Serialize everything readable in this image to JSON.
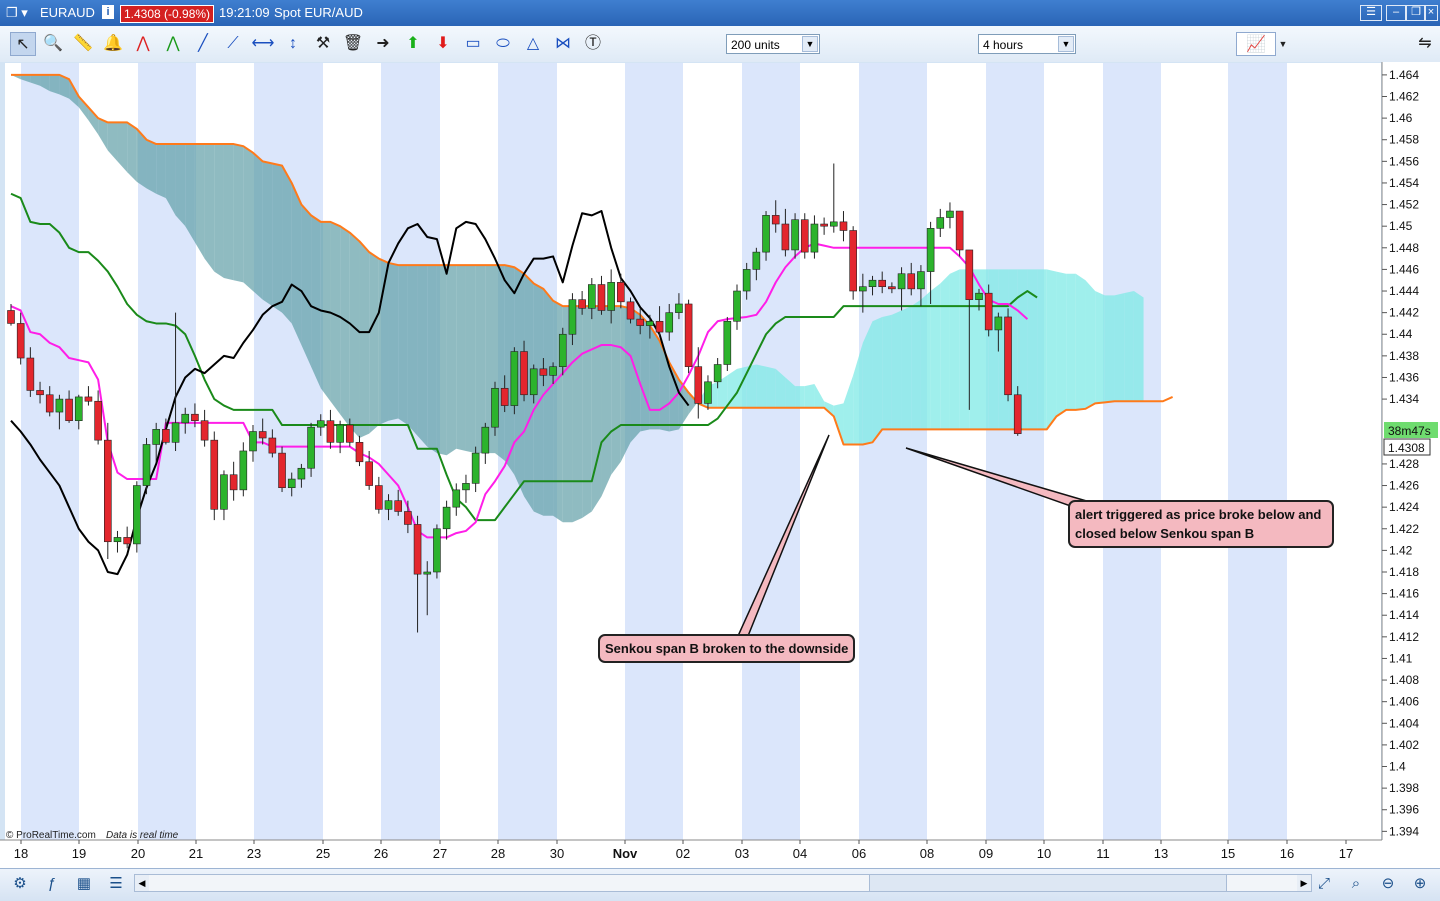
{
  "window": {
    "symbol": "EURAUD",
    "info_icon": "i",
    "price_change": "1.4308 (-0.98%)",
    "time": "19:21:09",
    "instrument": "Spot EUR/AUD"
  },
  "toolbar": {
    "tools": [
      "cursor-icon",
      "zoom-icon",
      "ruler-icon",
      "alert-bell-icon",
      "trend-line-red-icon",
      "trend-line-green-icon",
      "line-icon",
      "ray-icon",
      "horizontal-line-icon",
      "vertical-line-icon",
      "tools-icon",
      "trash-icon",
      "arrow-right-icon",
      "arrow-up-icon",
      "arrow-down-icon",
      "rectangle-icon",
      "ellipse-icon",
      "triangle-icon",
      "fibonacci-icon",
      "text-icon"
    ],
    "units_value": "200 units",
    "timeframe_value": "4 hours"
  },
  "chart_data": {
    "type": "candlestick",
    "instrument": "EUR/AUD",
    "y_axis": {
      "ticks": [
        "1.464",
        "1.462",
        "1.46",
        "1.458",
        "1.456",
        "1.454",
        "1.452",
        "1.45",
        "1.448",
        "1.446",
        "1.444",
        "1.442",
        "1.44",
        "1.438",
        "1.436",
        "1.434",
        "1.428",
        "1.426",
        "1.424",
        "1.422",
        "1.42",
        "1.418",
        "1.416",
        "1.414",
        "1.412",
        "1.41",
        "1.408",
        "1.406",
        "1.404",
        "1.402",
        "1.4",
        "1.398",
        "1.396",
        "1.394"
      ],
      "ylim": [
        1.3932,
        1.4651
      ]
    },
    "x_axis": {
      "ticks": [
        "18",
        "19",
        "20",
        "21",
        "23",
        "25",
        "26",
        "27",
        "28",
        "30",
        "Nov",
        "02",
        "03",
        "04",
        "06",
        "08",
        "09",
        "10",
        "11",
        "13",
        "15",
        "16",
        "17"
      ]
    },
    "countdown_label": "38m47s",
    "current_price_label": "1.4308",
    "current_price": 1.4308,
    "candles": [
      [
        1.4422,
        1.4428,
        1.4408,
        1.441
      ],
      [
        1.441,
        1.442,
        1.4372,
        1.4378
      ],
      [
        1.4378,
        1.4388,
        1.4342,
        1.4348
      ],
      [
        1.4348,
        1.4356,
        1.4336,
        1.4344
      ],
      [
        1.4344,
        1.4352,
        1.4324,
        1.4328
      ],
      [
        1.4328,
        1.4344,
        1.4312,
        1.434
      ],
      [
        1.434,
        1.4348,
        1.4318,
        1.432
      ],
      [
        1.432,
        1.4344,
        1.4312,
        1.4342
      ],
      [
        1.4342,
        1.4352,
        1.4334,
        1.4338
      ],
      [
        1.4338,
        1.4348,
        1.4298,
        1.4302
      ],
      [
        1.4302,
        1.4318,
        1.4192,
        1.4208
      ],
      [
        1.4208,
        1.4218,
        1.4198,
        1.4212
      ],
      [
        1.4212,
        1.4222,
        1.4202,
        1.4206
      ],
      [
        1.4206,
        1.4264,
        1.4198,
        1.426
      ],
      [
        1.426,
        1.4304,
        1.4252,
        1.4298
      ],
      [
        1.4298,
        1.4318,
        1.4282,
        1.4312
      ],
      [
        1.4312,
        1.4322,
        1.4298,
        1.43
      ],
      [
        1.43,
        1.442,
        1.4292,
        1.4318
      ],
      [
        1.4318,
        1.4332,
        1.4308,
        1.4326
      ],
      [
        1.4326,
        1.4336,
        1.4314,
        1.432
      ],
      [
        1.432,
        1.433,
        1.4296,
        1.4302
      ],
      [
        1.4302,
        1.431,
        1.4228,
        1.4238
      ],
      [
        1.4238,
        1.4274,
        1.4228,
        1.427
      ],
      [
        1.427,
        1.4282,
        1.4246,
        1.4256
      ],
      [
        1.4256,
        1.43,
        1.425,
        1.4292
      ],
      [
        1.4292,
        1.4316,
        1.4282,
        1.431
      ],
      [
        1.431,
        1.4322,
        1.4298,
        1.4304
      ],
      [
        1.4304,
        1.4312,
        1.4286,
        1.429
      ],
      [
        1.429,
        1.4296,
        1.4254,
        1.4258
      ],
      [
        1.4258,
        1.4272,
        1.425,
        1.4266
      ],
      [
        1.4266,
        1.428,
        1.4258,
        1.4276
      ],
      [
        1.4276,
        1.4318,
        1.4268,
        1.4314
      ],
      [
        1.4314,
        1.4326,
        1.4306,
        1.432
      ],
      [
        1.432,
        1.433,
        1.4294,
        1.43
      ],
      [
        1.43,
        1.432,
        1.429,
        1.4316
      ],
      [
        1.4316,
        1.4322,
        1.4296,
        1.43
      ],
      [
        1.43,
        1.4306,
        1.4278,
        1.4282
      ],
      [
        1.4282,
        1.4292,
        1.4256,
        1.426
      ],
      [
        1.426,
        1.4268,
        1.4234,
        1.4238
      ],
      [
        1.4238,
        1.4252,
        1.4228,
        1.4246
      ],
      [
        1.4246,
        1.4256,
        1.4232,
        1.4236
      ],
      [
        1.4236,
        1.4246,
        1.4216,
        1.4224
      ],
      [
        1.4224,
        1.4232,
        1.4124,
        1.4178
      ],
      [
        1.4178,
        1.419,
        1.414,
        1.418
      ],
      [
        1.418,
        1.4224,
        1.4174,
        1.422
      ],
      [
        1.422,
        1.4246,
        1.421,
        1.424
      ],
      [
        1.424,
        1.4262,
        1.4232,
        1.4256
      ],
      [
        1.4256,
        1.427,
        1.4244,
        1.4262
      ],
      [
        1.4262,
        1.4296,
        1.4254,
        1.429
      ],
      [
        1.429,
        1.4318,
        1.428,
        1.4314
      ],
      [
        1.4314,
        1.4356,
        1.4306,
        1.435
      ],
      [
        1.435,
        1.4362,
        1.4328,
        1.4334
      ],
      [
        1.4334,
        1.4388,
        1.4326,
        1.4384
      ],
      [
        1.4384,
        1.4394,
        1.4338,
        1.4344
      ],
      [
        1.4344,
        1.4372,
        1.4336,
        1.4368
      ],
      [
        1.4368,
        1.4378,
        1.4352,
        1.4362
      ],
      [
        1.4362,
        1.4374,
        1.4354,
        1.437
      ],
      [
        1.437,
        1.4406,
        1.4362,
        1.44
      ],
      [
        1.44,
        1.4438,
        1.439,
        1.4432
      ],
      [
        1.4432,
        1.444,
        1.4418,
        1.4424
      ],
      [
        1.4424,
        1.4452,
        1.4414,
        1.4446
      ],
      [
        1.4446,
        1.4454,
        1.4418,
        1.4422
      ],
      [
        1.4422,
        1.446,
        1.441,
        1.4448
      ],
      [
        1.4448,
        1.4456,
        1.4424,
        1.443
      ],
      [
        1.443,
        1.4434,
        1.441,
        1.4414
      ],
      [
        1.4414,
        1.4424,
        1.44,
        1.4408
      ],
      [
        1.4408,
        1.4418,
        1.4396,
        1.4412
      ],
      [
        1.4412,
        1.4426,
        1.4398,
        1.4402
      ],
      [
        1.4402,
        1.4428,
        1.4394,
        1.442
      ],
      [
        1.442,
        1.4438,
        1.4414,
        1.4428
      ],
      [
        1.4428,
        1.4432,
        1.4364,
        1.437
      ],
      [
        1.437,
        1.4388,
        1.4322,
        1.4336
      ],
      [
        1.4336,
        1.4362,
        1.433,
        1.4356
      ],
      [
        1.4356,
        1.4378,
        1.435,
        1.4372
      ],
      [
        1.4372,
        1.4416,
        1.4366,
        1.4412
      ],
      [
        1.4412,
        1.4446,
        1.4404,
        1.444
      ],
      [
        1.444,
        1.4466,
        1.4432,
        1.446
      ],
      [
        1.446,
        1.448,
        1.445,
        1.4476
      ],
      [
        1.4476,
        1.4514,
        1.4468,
        1.451
      ],
      [
        1.451,
        1.4524,
        1.4494,
        1.4502
      ],
      [
        1.4502,
        1.4516,
        1.4472,
        1.4478
      ],
      [
        1.4478,
        1.4512,
        1.447,
        1.4506
      ],
      [
        1.4506,
        1.4512,
        1.447,
        1.4476
      ],
      [
        1.4476,
        1.451,
        1.447,
        1.4502
      ],
      [
        1.4502,
        1.4508,
        1.4492,
        1.45
      ],
      [
        1.45,
        1.4558,
        1.4494,
        1.4504
      ],
      [
        1.4504,
        1.4514,
        1.4486,
        1.4496
      ],
      [
        1.4496,
        1.45,
        1.4432,
        1.444
      ],
      [
        1.444,
        1.4456,
        1.442,
        1.4444
      ],
      [
        1.4444,
        1.4454,
        1.4436,
        1.445
      ],
      [
        1.445,
        1.4458,
        1.4438,
        1.4444
      ],
      [
        1.4444,
        1.4448,
        1.4438,
        1.4442
      ],
      [
        1.4442,
        1.4462,
        1.4422,
        1.4456
      ],
      [
        1.4456,
        1.4466,
        1.4436,
        1.4442
      ],
      [
        1.4442,
        1.4464,
        1.4426,
        1.4458
      ],
      [
        1.4458,
        1.4504,
        1.4428,
        1.4498
      ],
      [
        1.4498,
        1.4516,
        1.449,
        1.4508
      ],
      [
        1.4508,
        1.4522,
        1.4498,
        1.4514
      ],
      [
        1.4514,
        1.4504,
        1.4472,
        1.4478
      ],
      [
        1.4478,
        1.4478,
        1.433,
        1.4432
      ],
      [
        1.4432,
        1.4442,
        1.4422,
        1.4438
      ],
      [
        1.4438,
        1.4446,
        1.4398,
        1.4404
      ],
      [
        1.4404,
        1.442,
        1.4384,
        1.4416
      ],
      [
        1.4416,
        1.4424,
        1.4338,
        1.4344
      ],
      [
        1.4344,
        1.4352,
        1.4306,
        1.4308
      ]
    ],
    "ichimoku": {
      "tenkan_sen": [
        1.4426,
        1.4422,
        1.4402,
        1.44,
        1.4392,
        1.4388,
        1.4378,
        1.4376,
        1.4374,
        1.4358,
        1.43,
        1.4272,
        1.4266,
        1.4266,
        1.4266,
        1.4266,
        1.4318,
        1.4318,
        1.4318,
        1.4318,
        1.4318,
        1.4318,
        1.4318,
        1.4318,
        1.4318,
        1.43,
        1.43,
        1.4296,
        1.4296,
        1.4296,
        1.4296,
        1.4296,
        1.4296,
        1.4296,
        1.4296,
        1.4296,
        1.429,
        1.4286,
        1.428,
        1.427,
        1.426,
        1.424,
        1.4218,
        1.4212,
        1.4212,
        1.4212,
        1.4216,
        1.4218,
        1.4226,
        1.4252,
        1.4264,
        1.4278,
        1.43,
        1.431,
        1.433,
        1.4344,
        1.4354,
        1.4364,
        1.4374,
        1.4382,
        1.4386,
        1.439,
        1.439,
        1.4388,
        1.438,
        1.4354,
        1.433,
        1.433,
        1.4336,
        1.4346,
        1.4362,
        1.438,
        1.4402,
        1.4412,
        1.4414,
        1.4415,
        1.4416,
        1.4418,
        1.443,
        1.4448,
        1.4462,
        1.4472,
        1.448,
        1.4484,
        1.4482,
        1.448,
        1.448,
        1.448,
        1.448,
        1.448,
        1.448,
        1.448,
        1.448,
        1.448,
        1.448,
        1.448,
        1.448,
        1.448,
        1.4472,
        1.4462,
        1.4446,
        1.4432,
        1.4428,
        1.4428,
        1.4422,
        1.4414
      ],
      "kijun_sen": [
        1.453,
        1.4526,
        1.4504,
        1.4502,
        1.4502,
        1.4494,
        1.448,
        1.4476,
        1.4476,
        1.4468,
        1.4458,
        1.4444,
        1.4428,
        1.4418,
        1.4412,
        1.441,
        1.441,
        1.4408,
        1.44,
        1.438,
        1.4358,
        1.434,
        1.4334,
        1.433,
        1.433,
        1.433,
        1.433,
        1.433,
        1.4316,
        1.4316,
        1.4316,
        1.4316,
        1.4316,
        1.4316,
        1.4316,
        1.4316,
        1.4316,
        1.4316,
        1.4316,
        1.4316,
        1.4316,
        1.4316,
        1.4294,
        1.4294,
        1.4294,
        1.427,
        1.4248,
        1.424,
        1.4228,
        1.4228,
        1.4228,
        1.424,
        1.4252,
        1.4264,
        1.4264,
        1.4264,
        1.4264,
        1.4264,
        1.4264,
        1.4264,
        1.4264,
        1.43,
        1.431,
        1.4316,
        1.4316,
        1.4316,
        1.4316,
        1.4316,
        1.4316,
        1.4316,
        1.4316,
        1.4316,
        1.4316,
        1.4322,
        1.4334,
        1.4346,
        1.4364,
        1.4382,
        1.44,
        1.441,
        1.4416,
        1.4416,
        1.4416,
        1.4416,
        1.4416,
        1.4416,
        1.4426,
        1.4426,
        1.4426,
        1.4426,
        1.4426,
        1.4426,
        1.4426,
        1.4426,
        1.4426,
        1.4426,
        1.4426,
        1.4426,
        1.4426,
        1.4426,
        1.4426,
        1.4426,
        1.4426,
        1.4426,
        1.4434,
        1.444,
        1.4434
      ],
      "chikou_span": [
        1.432,
        1.431,
        1.4298,
        1.4284,
        1.4272,
        1.426,
        1.424,
        1.422,
        1.4208,
        1.42,
        1.418,
        1.4178,
        1.4196,
        1.423,
        1.4258,
        1.428,
        1.4312,
        1.4342,
        1.436,
        1.4368,
        1.4364,
        1.4372,
        1.438,
        1.4378,
        1.4392,
        1.4404,
        1.4418,
        1.4426,
        1.443,
        1.4446,
        1.444,
        1.4426,
        1.4422,
        1.442,
        1.4416,
        1.441,
        1.4402,
        1.4402,
        1.442,
        1.4466,
        1.4484,
        1.4498,
        1.4502,
        1.449,
        1.4488,
        1.4456,
        1.4498,
        1.4504,
        1.4502,
        1.4488,
        1.447,
        1.445,
        1.4438,
        1.4456,
        1.447,
        1.447,
        1.4472,
        1.4448,
        1.4482,
        1.4512,
        1.451,
        1.4514,
        1.448,
        1.4452,
        1.444,
        1.4425,
        1.4415,
        1.44,
        1.437,
        1.4346,
        1.4334
      ],
      "cloud": {
        "span_a": [
          1.464,
          1.4636,
          1.4633,
          1.463,
          1.4625,
          1.4622,
          1.4618,
          1.461,
          1.4598,
          1.4585,
          1.457,
          1.456,
          1.455,
          1.4541,
          1.4535,
          1.453,
          1.4526,
          1.451,
          1.45,
          1.4485,
          1.447,
          1.4458,
          1.4452,
          1.445,
          1.4448,
          1.444,
          1.4432,
          1.4426,
          1.442,
          1.441,
          1.439,
          1.437,
          1.435,
          1.4338,
          1.4326,
          1.4314,
          1.4304,
          1.4308,
          1.4316,
          1.432,
          1.4322,
          1.4316,
          1.4306,
          1.4296,
          1.429,
          1.4288,
          1.4294,
          1.4292,
          1.429,
          1.429,
          1.429,
          1.4283,
          1.427,
          1.425,
          1.4236,
          1.4232,
          1.4232,
          1.4226,
          1.4226,
          1.423,
          1.4236,
          1.425,
          1.427,
          1.4282,
          1.43,
          1.431,
          1.4312,
          1.4312,
          1.431,
          1.4312,
          1.4326,
          1.4338,
          1.4352,
          1.4356,
          1.4362,
          1.4368,
          1.437,
          1.4372,
          1.437,
          1.4368,
          1.436,
          1.4352,
          1.4352,
          1.4354,
          1.4338,
          1.4334,
          1.4336,
          1.4362,
          1.4392,
          1.4412,
          1.4416,
          1.4418,
          1.4422,
          1.4426,
          1.4432,
          1.444,
          1.4447,
          1.4456,
          1.446,
          1.446,
          1.446,
          1.446,
          1.446,
          1.446,
          1.446,
          1.446,
          1.446,
          1.446,
          1.4458,
          1.4456,
          1.4456,
          1.445,
          1.444,
          1.4436,
          1.4436,
          1.4438,
          1.444,
          1.4434
        ],
        "span_b": [
          1.464,
          1.464,
          1.464,
          1.464,
          1.464,
          1.464,
          1.4636,
          1.462,
          1.461,
          1.46,
          1.4596,
          1.4596,
          1.4596,
          1.459,
          1.458,
          1.4576,
          1.4576,
          1.4576,
          1.4576,
          1.4576,
          1.4576,
          1.4576,
          1.4576,
          1.4576,
          1.4574,
          1.4568,
          1.456,
          1.4558,
          1.4556,
          1.454,
          1.452,
          1.451,
          1.4504,
          1.4504,
          1.45,
          1.4494,
          1.4486,
          1.4476,
          1.447,
          1.4466,
          1.4464,
          1.4464,
          1.4464,
          1.4464,
          1.4464,
          1.4464,
          1.4464,
          1.4464,
          1.4464,
          1.4464,
          1.4464,
          1.4464,
          1.4462,
          1.4456,
          1.4447,
          1.4442,
          1.4431,
          1.4426,
          1.4426,
          1.4426,
          1.4426,
          1.4426,
          1.4426,
          1.4426,
          1.4424,
          1.4418,
          1.4408,
          1.4394,
          1.4374,
          1.4358,
          1.4346,
          1.4336,
          1.4332,
          1.4332,
          1.4332,
          1.4332,
          1.4332,
          1.4332,
          1.4332,
          1.4332,
          1.4332,
          1.4332,
          1.4332,
          1.4332,
          1.4332,
          1.4324,
          1.4298,
          1.4298,
          1.4298,
          1.43,
          1.4312,
          1.4312,
          1.4312,
          1.4312,
          1.4312,
          1.4312,
          1.4312,
          1.4312,
          1.4312,
          1.4312,
          1.4312,
          1.4312,
          1.4312,
          1.4312,
          1.4312,
          1.4312,
          1.4312,
          1.4312,
          1.4324,
          1.433,
          1.433,
          1.4331,
          1.4336,
          1.4337,
          1.4338,
          1.4338,
          1.4338,
          1.4338,
          1.4338,
          1.4338,
          1.4342
        ]
      }
    },
    "annotations": [
      {
        "text": "Senkou span B broken to the downside"
      },
      {
        "text": "alert triggered as price broke below and closed below Senkou span B"
      }
    ]
  },
  "footer": {
    "copyright": "© ProRealTime.com",
    "note": "Data is real time"
  },
  "bottom_bar": {
    "icons": [
      "chart-settings-icon",
      "indicator-icon",
      "table-icon",
      "layers-icon"
    ],
    "zoom_icons": [
      "autoscale-icon",
      "zoom-fit-icon",
      "zoom-out-icon",
      "zoom-in-icon"
    ]
  },
  "colors": {
    "bull": "#2cb32c",
    "bear": "#e3262d",
    "tenkan": "#ff1ee8",
    "kijun": "#1a8a1a",
    "chikou": "#000000",
    "span_b": "#ff7a1a",
    "cloud_bear": "#5f9ea6",
    "cloud_bull": "#7fe9e6",
    "band_blue": "#dbe6fb",
    "band_white": "#ffffff"
  }
}
